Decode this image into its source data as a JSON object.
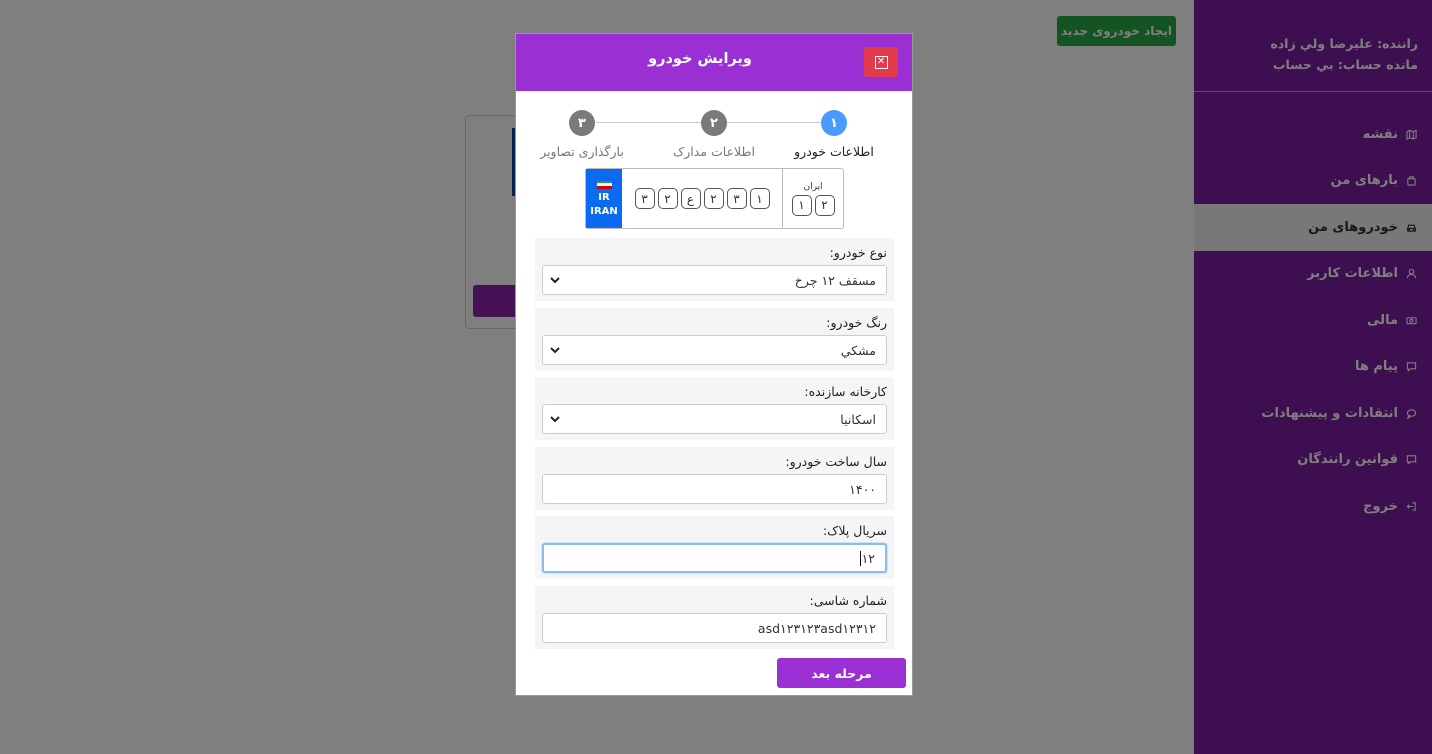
{
  "sidebar": {
    "driver_line": "راننده: عليرضا ولي زاده",
    "balance_line": "مانده حساب: بي حساب",
    "items": [
      {
        "label": "نقشه",
        "icon": "map-icon"
      },
      {
        "label": "بارهای من",
        "icon": "package-icon"
      },
      {
        "label": "خودروهای من",
        "icon": "car-icon",
        "active": true
      },
      {
        "label": "اطلاعات کاربر",
        "icon": "user-icon"
      },
      {
        "label": "مالی",
        "icon": "money-icon"
      },
      {
        "label": "پیام ها",
        "icon": "message-icon"
      },
      {
        "label": "انتقادات و پیشنهادات",
        "icon": "chat-icon"
      },
      {
        "label": "قوانین رانندگان",
        "icon": "rules-icon"
      },
      {
        "label": "خروج",
        "icon": "logout-icon"
      }
    ]
  },
  "page": {
    "new_vehicle_button": "ایجاد خودروی جدید"
  },
  "modal": {
    "title": "ویرایش خودرو",
    "close_icon": "close-icon",
    "steps": [
      {
        "number": "۱",
        "label": "اطلاعات خودرو",
        "active": true
      },
      {
        "number": "۲",
        "label": "اطلاعات مدارک",
        "active": false
      },
      {
        "number": "۳",
        "label": "بارگذاری تصاویر",
        "active": false
      }
    ],
    "plate": {
      "country_code": "IR",
      "country_name": "IRAN",
      "region_label": "ایران",
      "region_chars": [
        "۱",
        "۲"
      ],
      "main_chars": [
        "۳",
        "۲",
        "ع",
        "۲",
        "۳",
        "۱"
      ]
    },
    "fields": {
      "vehicle_type": {
        "label": "نوع خودرو:",
        "value": "مسقف ۱۲ چرخ"
      },
      "vehicle_color": {
        "label": "رنگ خودرو:",
        "value": "مشکي"
      },
      "manufacturer": {
        "label": "کارخانه سازنده:",
        "value": "اسکانيا"
      },
      "build_year": {
        "label": "سال ساخت خودرو:",
        "value": "۱۴۰۰"
      },
      "plate_serial": {
        "label": "سریال پلاک:",
        "value": "۱۲"
      },
      "chassis_number": {
        "label": "شماره شاسی:",
        "value": "asd۱۲۳۱۲۳asd۱۲۳۱۲"
      }
    },
    "next_button": "مرحله بعد"
  },
  "colors": {
    "sidebar": "#7a1fa2",
    "modal_header": "#9a2fd3",
    "active_step": "#4a9bff",
    "close_button": "#e23b4b",
    "new_button": "#28a745"
  }
}
